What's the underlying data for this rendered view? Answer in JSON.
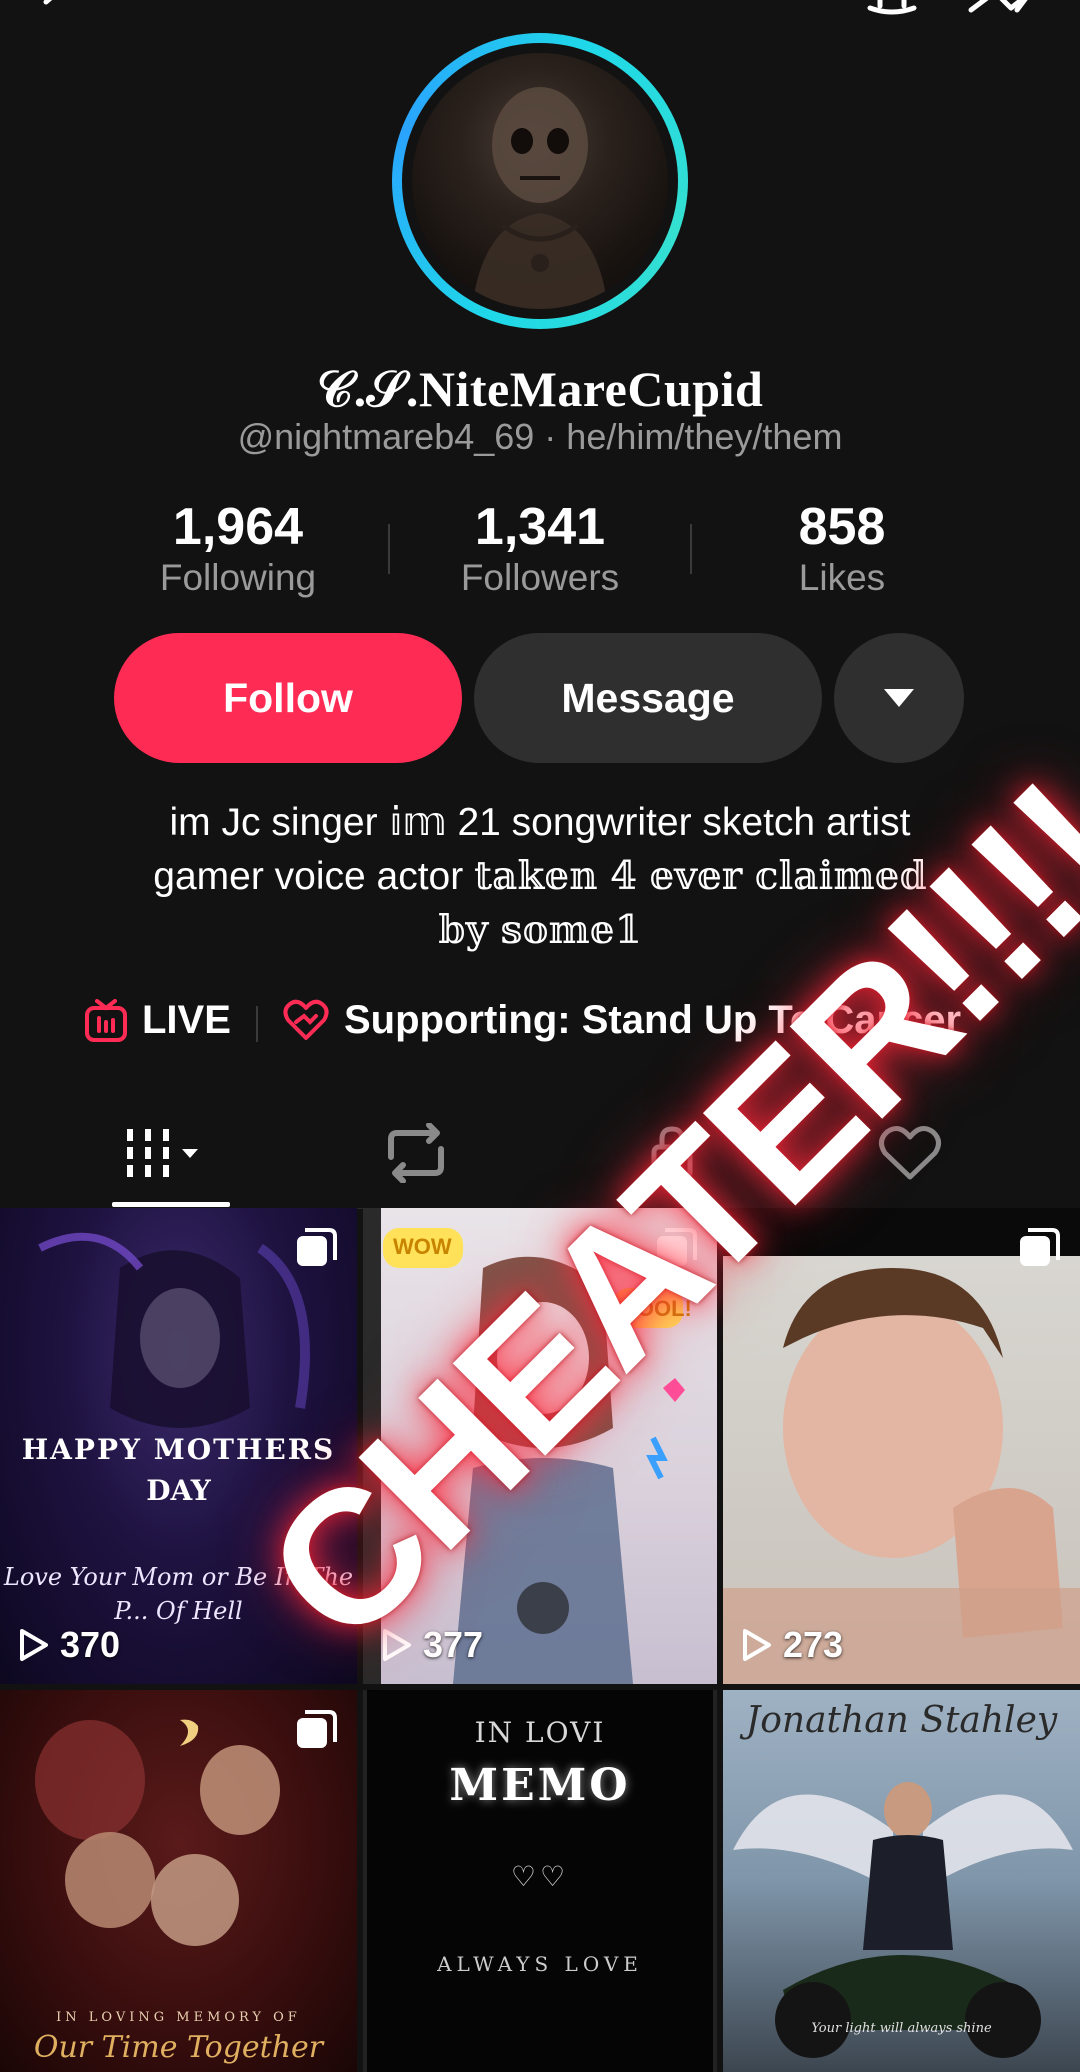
{
  "profile": {
    "display_name": "𝒞.𝒮.NiteMareCupid",
    "handle_line": "@nightmareb4_69 · he/him/they/them",
    "avatar_icon": "avatar-skull-portrait"
  },
  "stats": [
    {
      "value": "1,964",
      "label": "Following"
    },
    {
      "value": "1,341",
      "label": "Followers"
    },
    {
      "value": "858",
      "label": "Likes"
    }
  ],
  "actions": {
    "follow_label": "Follow",
    "message_label": "Message",
    "more_icon": "caret-down-icon"
  },
  "bio": {
    "line1": "im Jc singer 𝕚𝕞 21 songwriter sketch artist",
    "line2_plain": "gamer voice actor ",
    "line2_fancy": "𝕥𝕒𝕜𝕖𝕟 𝟜 𝕖𝕧𝕖𝕣 𝕔𝕝𝕒𝕚𝕞𝕖𝕕",
    "line3": "𝕓𝕪 𝕤𝕠𝕞𝕖𝟙"
  },
  "meta": {
    "live_label": "LIVE",
    "supporting_label": "Supporting: Stand Up To Cancer"
  },
  "tabs": [
    {
      "name": "videos",
      "icon": "grid-icon",
      "active": true
    },
    {
      "name": "reposts",
      "icon": "repost-icon",
      "active": false
    },
    {
      "name": "private",
      "icon": "lock-icon",
      "active": false
    },
    {
      "name": "liked",
      "icon": "heart-icon",
      "active": false
    }
  ],
  "videos": [
    {
      "views": "370",
      "multi": true,
      "lines": [
        "HAPPY MOTHERS",
        "DAY",
        "Love Your Mom or Be In The P... Of Hell"
      ]
    },
    {
      "views": "377",
      "multi": true,
      "lines": [
        "WOW",
        "COOL!"
      ]
    },
    {
      "views": "273",
      "multi": true,
      "lines": []
    },
    {
      "views": "",
      "multi": true,
      "lines": [
        "IN LOVING MEMORY OF",
        "Our Time Together"
      ]
    },
    {
      "views": "",
      "multi": false,
      "lines": [
        "IN LOVI",
        "MEMO",
        "♡♡",
        "ALWAYS LOVE"
      ]
    },
    {
      "views": "",
      "multi": false,
      "lines": [
        "Jonathan Stahley",
        "Your light will always shine"
      ]
    }
  ],
  "overlay": {
    "text": "CHEATER!!!!",
    "glow_color": "#ff2a3c"
  },
  "colors": {
    "background": "#121212",
    "accent": "#fe2c55",
    "secondary_button": "#2f2f2f",
    "muted_text": "#9a9a9a",
    "avatar_ring": "#1fd8e8"
  }
}
